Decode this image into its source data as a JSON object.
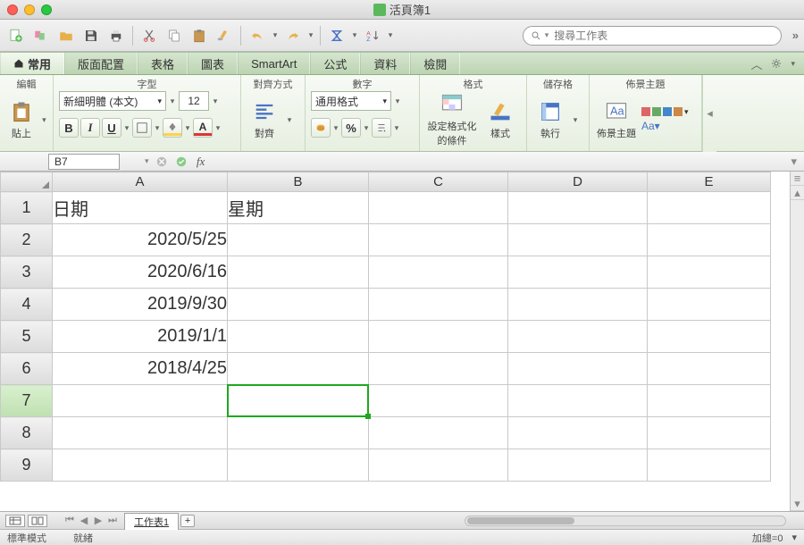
{
  "window": {
    "title": "活頁簿1"
  },
  "search": {
    "placeholder": "搜尋工作表"
  },
  "tabs": [
    "常用",
    "版面配置",
    "表格",
    "圖表",
    "SmartArt",
    "公式",
    "資料",
    "檢閱"
  ],
  "activeTab": 0,
  "ribbon": {
    "groups": {
      "edit": "編輯",
      "font": "字型",
      "align": "對齊方式",
      "number": "數字",
      "format": "格式",
      "cells": "儲存格",
      "theme": "佈景主題"
    },
    "paste_label": "貼上",
    "align_label": "對齊",
    "condfmt_label1": "設定格式化",
    "condfmt_label2": "的條件",
    "styles_label": "樣式",
    "run_label": "執行",
    "theme_label": "佈景主題",
    "aa_label": "Aa▾",
    "font_name": "新細明體 (本文)",
    "font_size": "12",
    "number_format": "通用格式"
  },
  "namebox": "B7",
  "columns": [
    "A",
    "B",
    "C",
    "D",
    "E"
  ],
  "rows": [
    "1",
    "2",
    "3",
    "4",
    "5",
    "6",
    "7",
    "8",
    "9"
  ],
  "cells": {
    "A1": "日期",
    "B1": "星期",
    "A2": "2020/5/25",
    "A3": "2020/6/16",
    "A4": "2019/9/30",
    "A5": "2019/1/1",
    "A6": "2018/4/25"
  },
  "selectedCell": "B7",
  "sheetTab": "工作表1",
  "status": {
    "mode": "標準模式",
    "ready": "就緒",
    "sum": "加總=0"
  }
}
